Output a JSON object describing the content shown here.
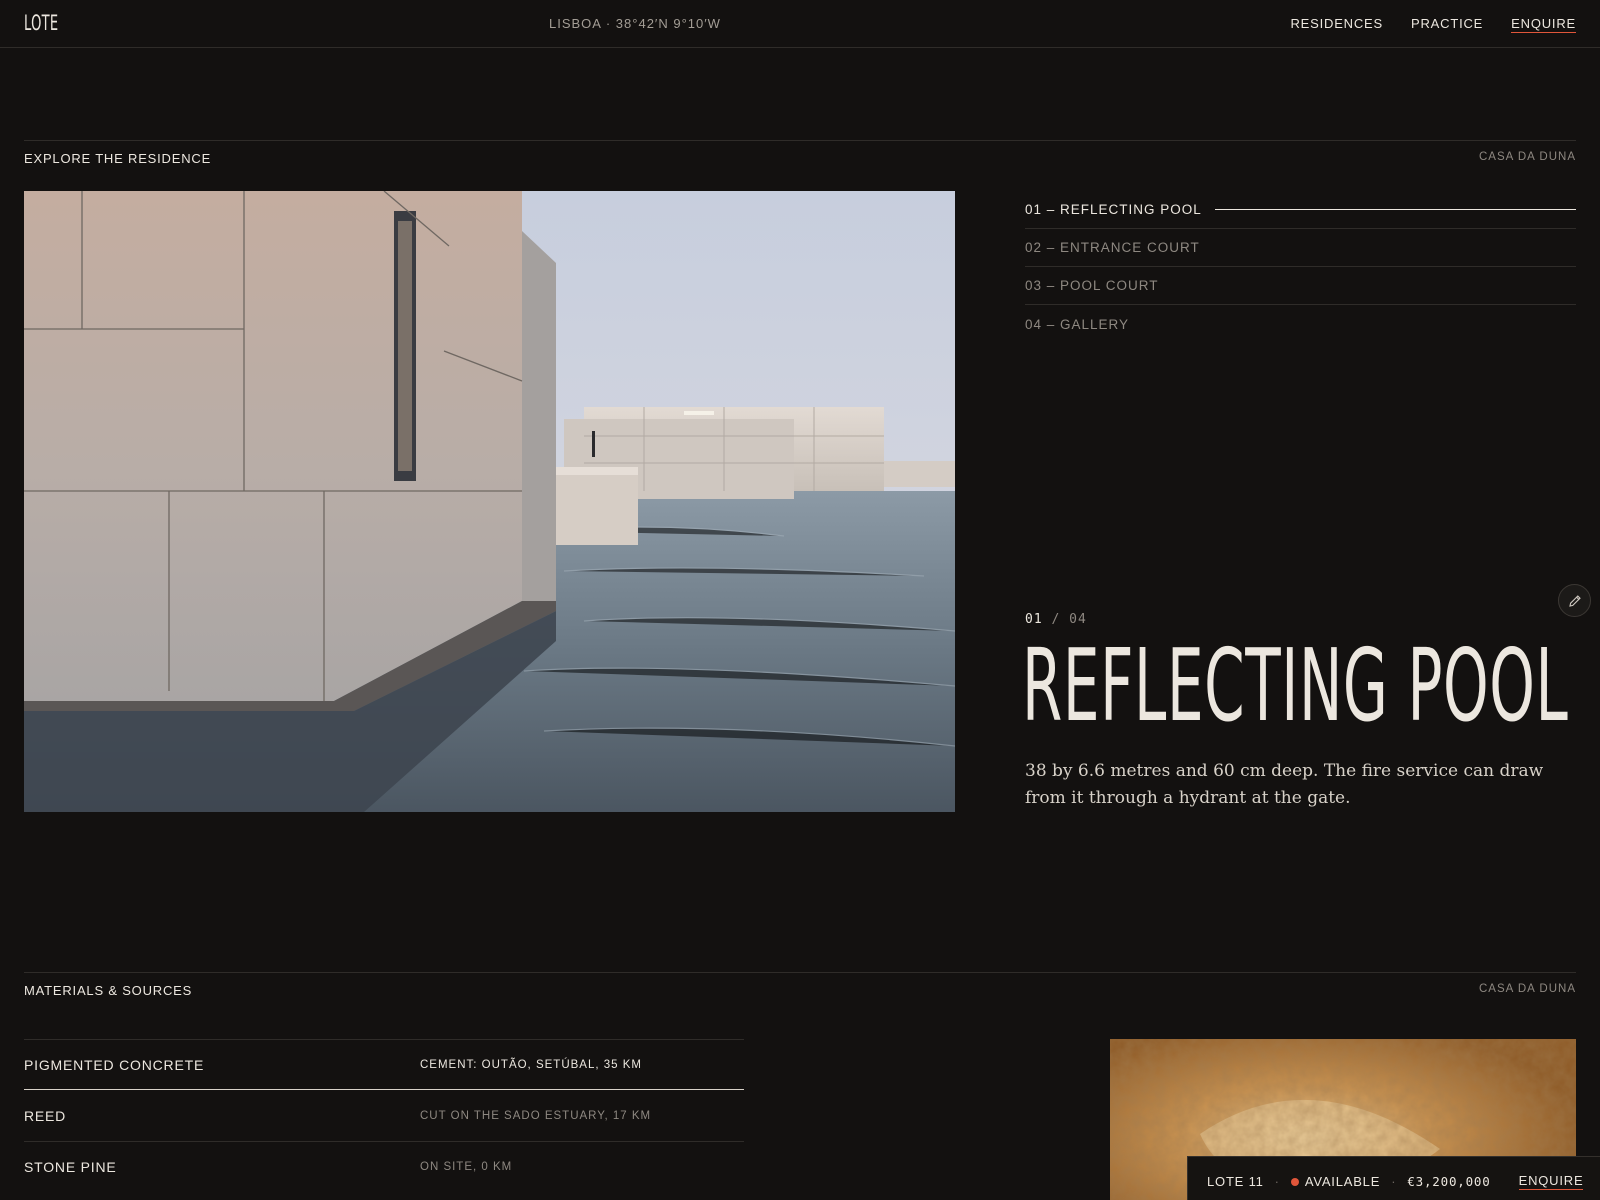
{
  "header": {
    "logo": "LOTE",
    "location": "LISBOA · 38°42′N 9°10′W",
    "nav": [
      "RESIDENCES",
      "PRACTICE",
      "ENQUIRE"
    ]
  },
  "explore": {
    "heading": "EXPLORE THE RESIDENCE",
    "residence": "CASA DA DUNA",
    "views": [
      "01 – REFLECTING POOL",
      "02 – ENTRANCE COURT",
      "03 – POOL COURT",
      "04 – GALLERY"
    ],
    "active_index": 0,
    "current": "01",
    "separator": "/",
    "total": "04",
    "title": "REFLECTING POOL",
    "description": "38 by 6.6 metres and 60 cm deep. The fire service can draw from it through a hydrant at the gate."
  },
  "materials": {
    "heading": "MATERIALS & SOURCES",
    "residence": "CASA DA DUNA",
    "rows": [
      {
        "name": "PIGMENTED CONCRETE",
        "source": "CEMENT: OUTÃO, SETÚBAL, 35 KM"
      },
      {
        "name": "REED",
        "source": "CUT ON THE SADO ESTUARY, 17 KM"
      },
      {
        "name": "STONE PINE",
        "source": "ON SITE, 0 KM"
      }
    ],
    "active_index": 0
  },
  "bottom_bar": {
    "lot": "LOTE 11",
    "sep": "·",
    "status": "AVAILABLE",
    "price": "€3,200,000",
    "cta": "ENQUIRE"
  },
  "colors": {
    "background": "#131110",
    "text": "#ece7df",
    "muted": "#8e8881",
    "accent": "#e0563a"
  },
  "icons": [
    "pencil-icon",
    "status-dot-icon"
  ]
}
